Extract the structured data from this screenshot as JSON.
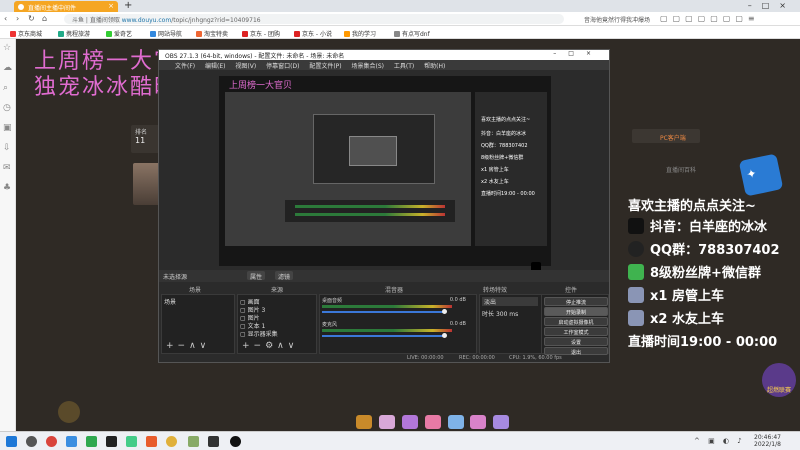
{
  "browser": {
    "tab_title": "直播间主播中间件",
    "url_host": "www.douyu.com",
    "url_path": "/topic/jnhgngz?rid=10409716",
    "url_prefix": "斗鱼 | 直播间领取",
    "search_hint": "音海他竟然行得我冲爆场",
    "bookmarks": [
      "京东商城",
      "携程旅游",
      "爱奇艺",
      "网站导航",
      "淘宝特卖",
      "京东 - 团购",
      "京东 - 小说",
      "我的学习",
      "有点写dnf"
    ]
  },
  "overlay": {
    "line1": "上周榜一大官贝",
    "line2": "独宠冰冰酷时闪烁"
  },
  "stream_info": {
    "follow": "喜欢主播的点点关注~",
    "douyin": "抖音：白羊座的冰冰",
    "qq": "QQ群：788307402",
    "fans": "8级粉丝牌+微信群",
    "room_mgr": "x1 房管上车",
    "water_friend": "x2 水友上车",
    "live_time": "直播时间19:00 - 00:00"
  },
  "page": {
    "left_card_label": "排名",
    "left_card_num": "11",
    "right_badge": "PC客户端",
    "right_list": "直播间百科",
    "mascot_label": "超燃联赛"
  },
  "obs": {
    "title": "OBS 27.1.3 (64-bit, windows) - 配置文件: 未命名 - 场景: 未命名",
    "menu": "文件(F) 编辑(E) 视图(V) 停靠窗口(D) 配置文件(P) 场景集合(S) 工具(T) 帮助(H)",
    "scenebar_label": "未选择源",
    "scenebar_props": "属性",
    "scenebar_filters": "滤镜",
    "docks": {
      "scenes_header": "场景",
      "sources_header": "来源",
      "mixer_header": "混音器",
      "transition_header": "转场特效",
      "controls_header": "控件"
    },
    "scenes": [
      "场景"
    ],
    "sources": [
      "画面",
      "图片 3",
      "图片",
      "文本 1",
      "显示器采集"
    ],
    "mixer": [
      {
        "name": "桌面音频",
        "db": "0.0 dB"
      },
      {
        "name": "麦克风",
        "db": "0.0 dB"
      }
    ],
    "transition": {
      "type": "淡出",
      "duration_label": "时长",
      "duration": "300 ms"
    },
    "controls": [
      "停止推流",
      "开始录制",
      "启动虚拟摄像机",
      "工作室模式",
      "设置",
      "退出"
    ],
    "status": {
      "live": "LIVE: 00:00:00",
      "rec": "REC: 00:00:00",
      "cpu": "CPU: 1.9%, 60.00 fps"
    }
  },
  "nested": {
    "pink": "上周榜一大官贝",
    "follow": "喜欢主播的点点关注~",
    "douyin": "抖音：白羊座的冰冰",
    "qq": "QQ群：788307402",
    "fans": "8级粉丝牌+微信群",
    "room_mgr": "x1 房管上车",
    "water_friend": "x2 水友上车",
    "live_time": "直播时间19:00 - 00:00"
  },
  "taskbar": {
    "time": "20:46:47",
    "date": "2022/1/8"
  },
  "colors": {
    "accent_pink": "#e06cd0",
    "tab_orange": "#f5a623",
    "obs_bg": "#2b2b2b"
  }
}
